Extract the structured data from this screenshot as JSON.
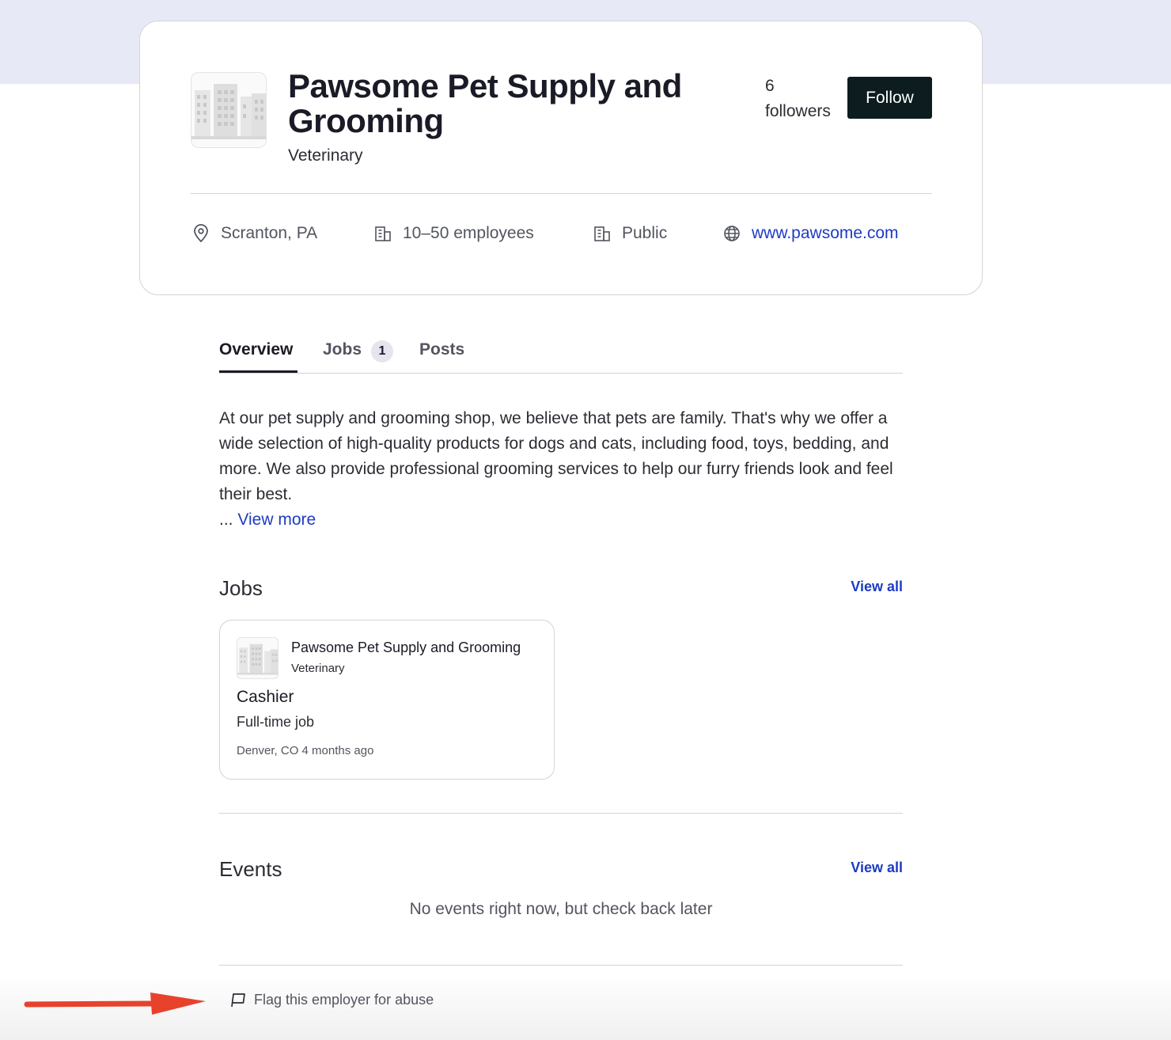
{
  "company": {
    "name": "Pawsome Pet Supply and Grooming",
    "industry": "Veterinary",
    "followers_count": "6",
    "followers_label": "followers",
    "follow_label": "Follow",
    "location": "Scranton, PA",
    "size": "10–50 employees",
    "type": "Public",
    "website": "www.pawsome.com"
  },
  "tabs": [
    {
      "label": "Overview",
      "active": true
    },
    {
      "label": "Jobs",
      "badge": "1"
    },
    {
      "label": "Posts"
    }
  ],
  "overview": {
    "description": "At our pet supply and grooming shop, we believe that pets are family. That's why we offer a wide selection of high-quality products for dogs and cats, including food, toys, bedding, and more. We also provide professional grooming services to help our furry friends look and feel their best.",
    "ellipsis": "...",
    "view_more": "View more"
  },
  "jobs_section": {
    "title": "Jobs",
    "view_all": "View all",
    "items": [
      {
        "company": "Pawsome Pet Supply and Grooming",
        "industry": "Veterinary",
        "title": "Cashier",
        "type": "Full-time job",
        "location": "Denver, CO",
        "posted": "4 months ago"
      }
    ]
  },
  "events_section": {
    "title": "Events",
    "view_all": "View all",
    "empty_message": "No events right now, but check back later"
  },
  "footer": {
    "flag_label": "Flag this employer for abuse"
  },
  "colors": {
    "accent_link": "#1d3bc4",
    "follow_button": "#0c1c1f",
    "header_band": "#e8e9f7",
    "annotation_arrow": "#e8412c"
  },
  "icons": [
    "map-pin-icon",
    "building-icon",
    "globe-icon",
    "flag-icon",
    "company-logo-placeholder",
    "annotation-arrow"
  ]
}
